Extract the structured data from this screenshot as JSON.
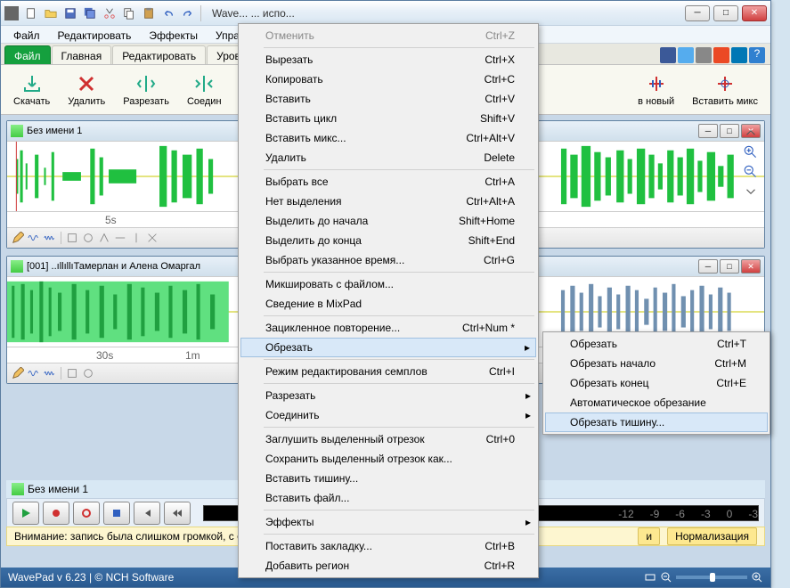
{
  "window": {
    "title": "Wave... ... испо..."
  },
  "menubar": [
    "Файл",
    "Редактировать",
    "Эффекты",
    "Управ"
  ],
  "tabs": [
    "Файл",
    "Главная",
    "Редактировать",
    "Уров"
  ],
  "active_tab": 0,
  "ribbon": [
    {
      "label": "Скачать"
    },
    {
      "label": "Удалить"
    },
    {
      "label": "Разрезать"
    },
    {
      "label": "Соедин"
    },
    {
      "label": "в новый"
    },
    {
      "label": "Вставить микс"
    }
  ],
  "docs": [
    {
      "title": "Без имени 1",
      "ruler": "5s"
    },
    {
      "title": "[001] ..ıllıllıТамерлан и Алена Омаргал",
      "ruler1": "30s",
      "ruler2": "1m"
    }
  ],
  "transport_title": "Без имени 1",
  "level_marks": [
    "-12",
    "-9",
    "-6",
    "-3",
    "0",
    "-3"
  ],
  "warning": {
    "text": "Внимание: запись была слишком громкой, с о",
    "btn1": "и",
    "btn2": "Нормализация"
  },
  "status": "WavePad v 6.23 | © NCH Software",
  "context_menu": [
    {
      "label": "Отменить",
      "sc": "Ctrl+Z",
      "disabled": true
    },
    {
      "sep": true
    },
    {
      "label": "Вырезать",
      "sc": "Ctrl+X"
    },
    {
      "label": "Копировать",
      "sc": "Ctrl+C"
    },
    {
      "label": "Вставить",
      "sc": "Ctrl+V"
    },
    {
      "label": "Вставить цикл",
      "sc": "Shift+V"
    },
    {
      "label": "Вставить микс...",
      "sc": "Ctrl+Alt+V"
    },
    {
      "label": "Удалить",
      "sc": "Delete"
    },
    {
      "sep": true
    },
    {
      "label": "Выбрать все",
      "sc": "Ctrl+A"
    },
    {
      "label": "Нет выделения",
      "sc": "Ctrl+Alt+A"
    },
    {
      "label": "Выделить до начала",
      "sc": "Shift+Home"
    },
    {
      "label": "Выделить до конца",
      "sc": "Shift+End"
    },
    {
      "label": "Выбрать указанное время...",
      "sc": "Ctrl+G"
    },
    {
      "sep": true
    },
    {
      "label": "Микшировать с файлом..."
    },
    {
      "label": "Сведение в MixPad"
    },
    {
      "sep": true
    },
    {
      "label": "Зацикленное повторение...",
      "sc": "Ctrl+Num *"
    },
    {
      "label": "Обрезать",
      "sub": true,
      "hov": true
    },
    {
      "sep": true
    },
    {
      "label": "Режим редактирования семплов",
      "sc": "Ctrl+I"
    },
    {
      "sep": true
    },
    {
      "label": "Разрезать",
      "sub": true
    },
    {
      "label": "Соединить",
      "sub": true
    },
    {
      "sep": true
    },
    {
      "label": "Заглушить выделенный отрезок",
      "sc": "Ctrl+0"
    },
    {
      "label": "Сохранить выделенный отрезок как..."
    },
    {
      "label": "Вставить тишину..."
    },
    {
      "label": "Вставить файл..."
    },
    {
      "sep": true
    },
    {
      "label": "Эффекты",
      "sub": true
    },
    {
      "sep": true
    },
    {
      "label": "Поставить закладку...",
      "sc": "Ctrl+B"
    },
    {
      "label": "Добавить регион",
      "sc": "Ctrl+R"
    }
  ],
  "submenu": [
    {
      "label": "Обрезать",
      "sc": "Ctrl+T"
    },
    {
      "label": "Обрезать начало",
      "sc": "Ctrl+M"
    },
    {
      "label": "Обрезать конец",
      "sc": "Ctrl+E"
    },
    {
      "label": "Автоматическое обрезание"
    },
    {
      "label": "Обрезать тишину...",
      "hov": true
    }
  ]
}
